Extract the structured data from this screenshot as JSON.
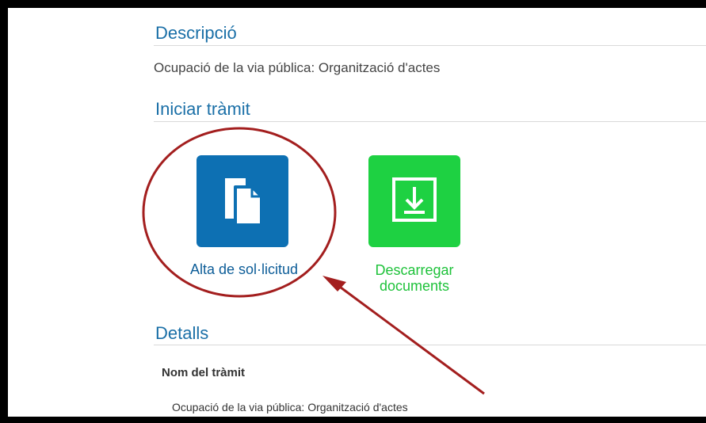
{
  "sections": {
    "description": {
      "title": "Descripció",
      "text": "Ocupació de la via pública: Organització d'actes"
    },
    "start": {
      "title": "Iniciar tràmit",
      "actions": [
        {
          "label": "Alta de sol·licitud",
          "icon": "documents-icon",
          "color": "#0d70b3"
        },
        {
          "label": "Descarregar documents",
          "icon": "download-icon",
          "color": "#1ed142"
        }
      ]
    },
    "details": {
      "title": "Detalls",
      "field_label": "Nom del tràmit",
      "field_value": "Ocupació de la via pública: Organització d'actes"
    }
  },
  "annotation": {
    "color": "#a31e1e",
    "shapes": [
      "circle-highlight",
      "arrow"
    ]
  }
}
